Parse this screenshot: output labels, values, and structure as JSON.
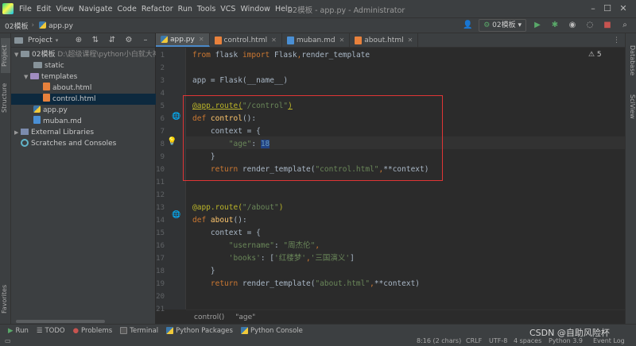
{
  "menubar": {
    "items": [
      "File",
      "Edit",
      "View",
      "Navigate",
      "Code",
      "Refactor",
      "Run",
      "Tools",
      "VCS",
      "Window",
      "Help"
    ],
    "window_title": "02模板 - app.py - Administrator"
  },
  "navbar": {
    "project": "02模板",
    "file": "app.py",
    "run_config": "02模板"
  },
  "project_panel": {
    "title": "Project",
    "tree": {
      "root": "02模板",
      "root_path": "D:\\超级课程\\python小白就大神",
      "static": "static",
      "templates": "templates",
      "about_html": "about.html",
      "control_html": "control.html",
      "app_py": "app.py",
      "muban_md": "muban.md",
      "external_libraries": "External Libraries",
      "scratches": "Scratches and Consoles"
    }
  },
  "editor_tabs": [
    "app.py",
    "control.html",
    "muban.md",
    "about.html"
  ],
  "code_lines": {
    "l1_from": "from",
    "l1_mod": " flask ",
    "l1_import": "import",
    "l1_rest": " Flask",
    "l1_comma": ",",
    "l1_rt": "render_template",
    "l3": "app = Flask(__name__)",
    "l5_dec": "@app.route(",
    "l5_str": "\"/control\"",
    "l5_end": ")",
    "l6_def": "def",
    "l6_fn": "control",
    "l6_rest": "():",
    "l7": "    context = {",
    "l8_indent": "        ",
    "l8_key": "\"age\"",
    "l8_colon": ": ",
    "l8_val": "18",
    "l9": "    }",
    "l10_ret": "    return",
    "l10_call": " render_template(",
    "l10_str": "\"control.html\"",
    "l10_comma": ",",
    "l10_rest": "**context)",
    "l13_dec": "@app.route(",
    "l13_str": "\"/about\"",
    "l13_end": ")",
    "l14_def": "def",
    "l14_fn": "about",
    "l14_rest": "():",
    "l15": "    context = {",
    "l16_indent": "        ",
    "l16_key": "\"username\"",
    "l16_colon": ": ",
    "l16_val": "\"周杰伦\"",
    "l16_end": ",",
    "l17_indent": "        ",
    "l17_key": "'books'",
    "l17_colon": ": [",
    "l17_v1": "'红楼梦'",
    "l17_comma": ",",
    "l17_v2": "'三国演义'",
    "l17_end": "]",
    "l18": "    }",
    "l19_ret": "    return",
    "l19_call": " render_template(",
    "l19_str": "\"about.html\"",
    "l19_comma": ",",
    "l19_rest": "**context)"
  },
  "line_numbers": [
    "1",
    "2",
    "3",
    "4",
    "5",
    "6",
    "7",
    "8",
    "9",
    "10",
    "11",
    "12",
    "13",
    "14",
    "15",
    "16",
    "17",
    "18",
    "19",
    "20",
    "21"
  ],
  "inspection": "⚠ 5",
  "breadcrumb": [
    "control()",
    "\"age\""
  ],
  "left_strip_tabs": [
    "Project",
    "Structure",
    "Favorites"
  ],
  "right_strip_tabs": [
    "Database",
    "SciView"
  ],
  "toolwindows": [
    "Run",
    "TODO",
    "Problems",
    "Terminal",
    "Python Packages",
    "Python Console"
  ],
  "statusbar": {
    "position": "8:16 (2 chars)",
    "line_sep": "CRLF",
    "encoding": "UTF-8",
    "indent": "4 spaces",
    "interpreter": "Python 3.9",
    "event_log": "Event Log"
  },
  "watermark": "CSDN @自助风险杯",
  "colors": {
    "accent": "#4a88c7",
    "highlight_box": "#e03535",
    "selection": "#0d293e"
  }
}
